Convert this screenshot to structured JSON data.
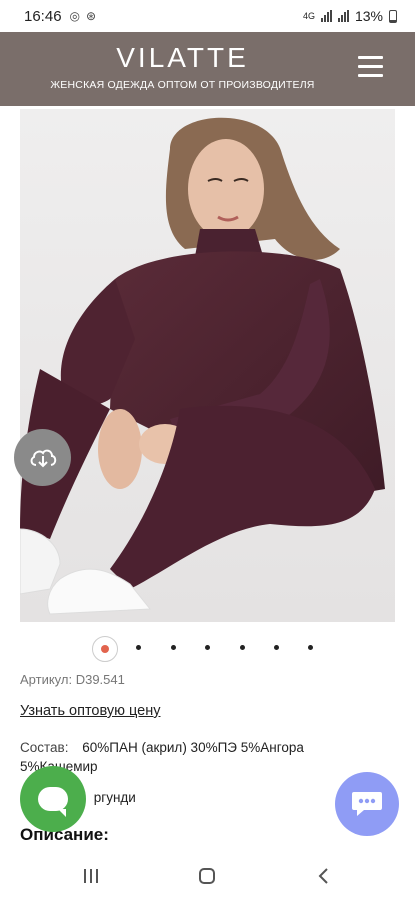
{
  "status_bar": {
    "time": "16:46",
    "network": "4G",
    "battery": "13%"
  },
  "header": {
    "brand": "VILATTE",
    "tagline": "ЖЕНСКАЯ ОДЕЖДА ОПТОМ ОТ ПРОИЗВОДИТЕЛЯ",
    "menu_icon": "hamburger-icon"
  },
  "gallery": {
    "slide_count": 7,
    "active_slide": 1,
    "download_icon": "cloud-download-icon"
  },
  "product": {
    "article_label": "Артикул:",
    "article_value": "D39.541",
    "price_link": "Узнать оптовую цену",
    "composition_label": "Состав:",
    "composition_value": "60%ПАН (акрил) 30%ПЭ 5%Ангора 5%Кашемир",
    "color_partial": "ргунди",
    "description_title": "Описание:"
  },
  "colors": {
    "header_bg": "#7a6e6a",
    "accent_dot": "#e2644e",
    "chat_green": "#4cae4c",
    "chat_blue": "#8f9cf5"
  },
  "nav": {
    "recent_icon": "recent-apps-icon",
    "home_icon": "home-icon",
    "back_icon": "back-icon"
  }
}
